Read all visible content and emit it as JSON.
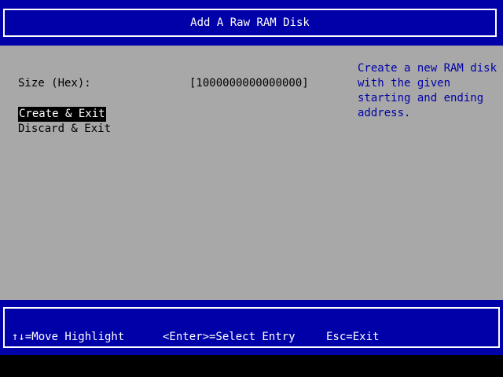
{
  "header": {
    "title": "Add A Raw RAM Disk"
  },
  "form": {
    "size_label": "Size (Hex):",
    "size_value": "[1000000000000000]"
  },
  "menu": {
    "create_exit": "Create & Exit",
    "discard_exit": "Discard & Exit"
  },
  "help": {
    "lines": [
      "Create a new RAM disk",
      "with the given",
      "starting and ending",
      "address."
    ]
  },
  "footer": {
    "move": "↑↓=Move Highlight",
    "enter": "<Enter>=Select Entry",
    "esc": "Esc=Exit"
  },
  "colors": {
    "band": "#0000a8",
    "body": "#a8a8a8",
    "help_text": "#0000a8",
    "highlight_bg": "#000000",
    "highlight_fg": "#ffffff"
  }
}
